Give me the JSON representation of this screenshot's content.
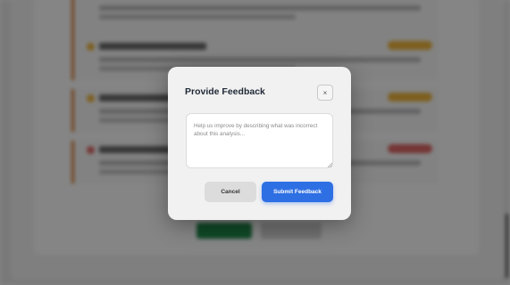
{
  "modal": {
    "title": "Provide Feedback",
    "close_label": "×",
    "feedback_placeholder": "Help us improve by describing what was incorrect about this analysis...",
    "feedback_value": "",
    "cancel_label": "Cancel",
    "submit_label": "Submit Feedback"
  },
  "colors": {
    "primary": "#2e6fe4",
    "severity_high": "#e06666",
    "severity_medium": "#f0b63c",
    "approve_button": "#1e8a4a",
    "finding_border": "#d87a2c"
  }
}
